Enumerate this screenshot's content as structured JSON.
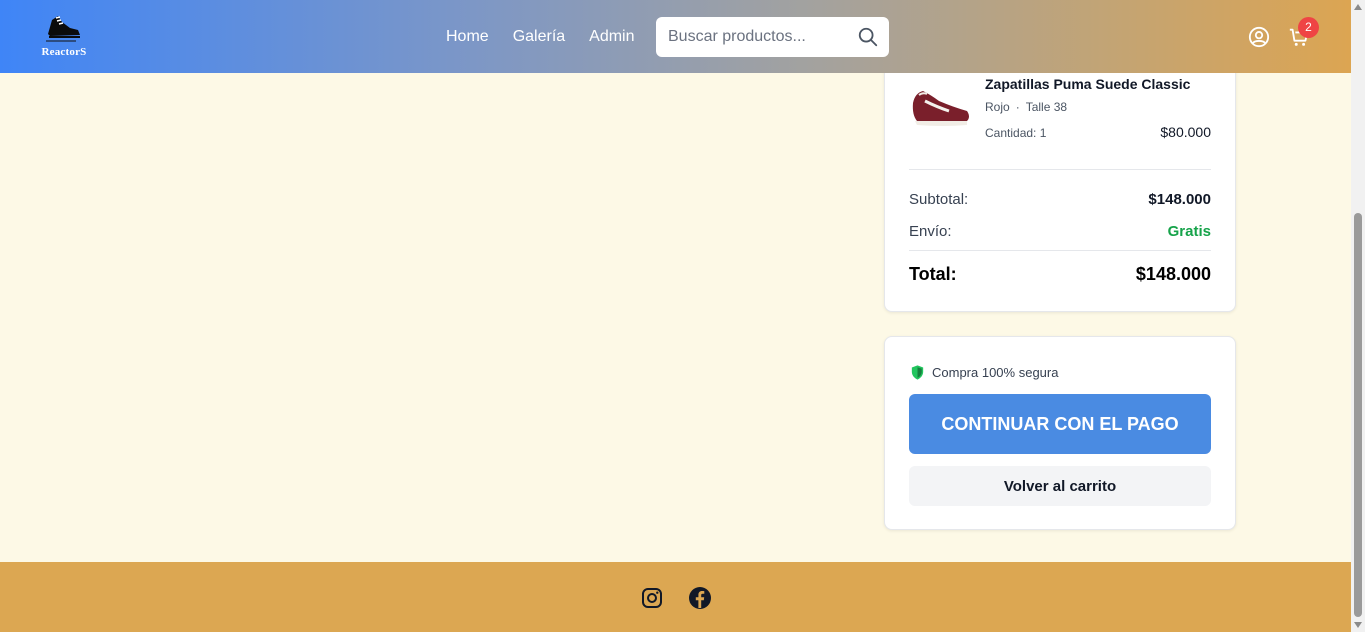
{
  "brand": {
    "logo_text": "ReactorS"
  },
  "nav": {
    "links": [
      "Home",
      "Galería",
      "Admin"
    ]
  },
  "search": {
    "placeholder": "Buscar productos..."
  },
  "cart": {
    "badge_count": "2"
  },
  "summary": {
    "item": {
      "name": "Zapatillas Puma Suede Classic",
      "color": "Rojo",
      "size": "Talle 38",
      "quantity": "Cantidad: 1",
      "price": "$80.000"
    },
    "subtotal_label": "Subtotal:",
    "subtotal_value": "$148.000",
    "shipping_label": "Envío:",
    "shipping_value": "Gratis",
    "total_label": "Total:",
    "total_value": "$148.000"
  },
  "payment": {
    "secure_text": "Compra 100% segura",
    "continue_label": "CONTINUAR CON EL PAGO",
    "back_label": "Volver al carrito"
  },
  "colors": {
    "primary_button": "#4a8be2",
    "footer": "#dca752",
    "free_shipping": "#16a34a",
    "badge": "#ef4444"
  }
}
